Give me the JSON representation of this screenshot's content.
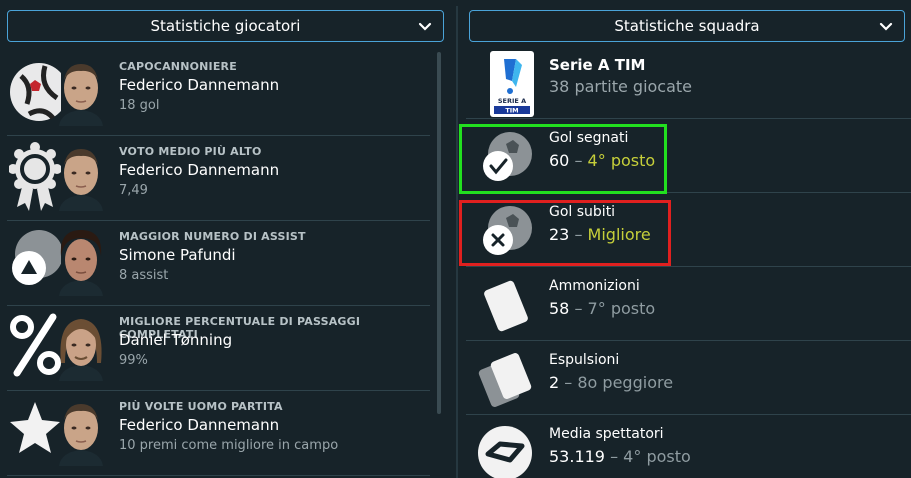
{
  "left_panel": {
    "dropdown_label": "Statistiche giocatori",
    "rows": [
      {
        "caption": "CAPOCANNONIERE",
        "player": "Federico Dannemann",
        "value": "18 gol",
        "icon": "ball-icon"
      },
      {
        "caption": "VOTO MEDIO PIÙ ALTO",
        "player": "Federico Dannemann",
        "value": "7,49",
        "icon": "rosette-icon"
      },
      {
        "caption": "MAGGIOR NUMERO DI ASSIST",
        "player": "Simone Pafundi",
        "value": "8 assist",
        "icon": "assist-icon"
      },
      {
        "caption": "MIGLIORE PERCENTUALE DI PASSAGGI COMPLETATI",
        "player": "Daniel Tønning",
        "value": "99%",
        "icon": "percent-icon"
      },
      {
        "caption": "PIÙ VOLTE UOMO PARTITA",
        "player": "Federico Dannemann",
        "value": "10 premi come migliore in campo",
        "icon": "star-icon"
      }
    ]
  },
  "right_panel": {
    "dropdown_label": "Statistiche squadra",
    "league": {
      "name": "Serie A TIM",
      "subtitle": "38 partite giocate",
      "logo_text_top": "SERIE A",
      "logo_text_bottom": "TIM"
    },
    "rows": [
      {
        "label": "Gol segnati",
        "value": "60",
        "separator": "–",
        "rank": "4° posto",
        "highlight_rank": true,
        "icon": "goals-scored-icon",
        "box_color": "#22e01f"
      },
      {
        "label": "Gol subiti",
        "value": "23",
        "separator": "–",
        "rank": "Migliore",
        "highlight_rank": true,
        "icon": "goals-conceded-icon",
        "box_color": "#e0201f"
      },
      {
        "label": "Ammonizioni",
        "value": "58",
        "separator": "–",
        "rank": "7° posto",
        "highlight_rank": false,
        "icon": "yellow-card-icon"
      },
      {
        "label": "Espulsioni",
        "value": "2",
        "separator": "–",
        "rank": "8o peggiore",
        "highlight_rank": false,
        "icon": "red-card-icon"
      },
      {
        "label": "Media spettatori",
        "value": "53.119",
        "separator": "–",
        "rank": "4° posto",
        "highlight_rank": false,
        "icon": "stadium-icon"
      }
    ]
  },
  "colors": {
    "background": "#172329",
    "accent_border": "#4aa3d8",
    "highlight_rank": "#c6cf3a",
    "row_divider": "#2f434b"
  }
}
